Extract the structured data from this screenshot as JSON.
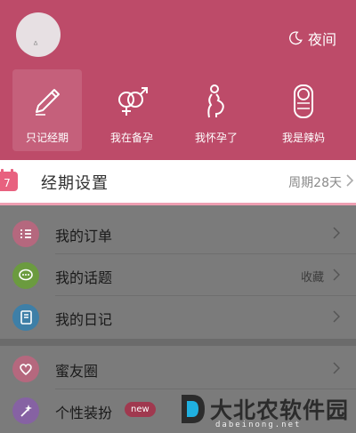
{
  "header": {
    "night_mode_label": "夜间",
    "modes": [
      {
        "label": "只记经期",
        "icon": "pen-icon",
        "selected": true
      },
      {
        "label": "我在备孕",
        "icon": "gender-symbols-icon",
        "selected": false
      },
      {
        "label": "我怀孕了",
        "icon": "pregnant-icon",
        "selected": false
      },
      {
        "label": "我是辣妈",
        "icon": "baby-icon",
        "selected": false
      }
    ],
    "color": "#bd4b69"
  },
  "period_settings": {
    "title": "经期设置",
    "value": "周期28天",
    "icon": "calendar-icon"
  },
  "menu": [
    {
      "label": "我的订单",
      "value": "",
      "icon": "order-list-icon",
      "icon_color": "#b5687e"
    },
    {
      "label": "我的话题",
      "value": "收藏",
      "icon": "chat-bubble-icon",
      "icon_color": "#6b9b3f"
    },
    {
      "label": "我的日记",
      "value": "",
      "icon": "diary-icon",
      "icon_color": "#3e7fa7"
    }
  ],
  "menu2": [
    {
      "label": "蜜友圈",
      "value": "",
      "icon": "heart-circle-icon",
      "icon_color": "#b5687e"
    },
    {
      "label": "个性装扮",
      "badge": "new",
      "icon": "magic-wand-icon",
      "icon_color": "#8662a3"
    }
  ],
  "watermark": {
    "text": "大北农软件园",
    "sub": "dabeinong.net"
  }
}
